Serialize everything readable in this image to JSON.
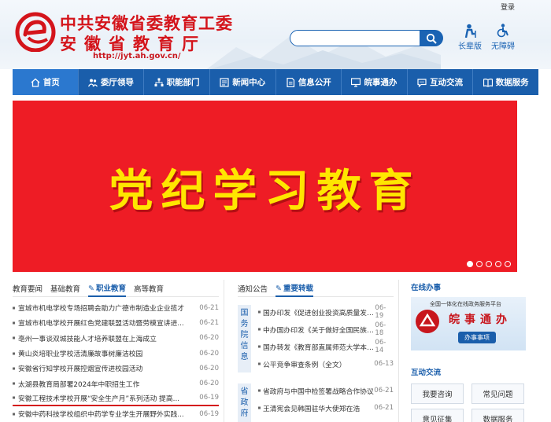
{
  "header": {
    "login": "登录",
    "title_line1": "中共安徽省委教育工委",
    "title_line2": "安徽省教育厅",
    "url": "http://jyt.ah.gov.cn/",
    "tools": [
      {
        "label": "长辈版",
        "icon": "elder-icon"
      },
      {
        "label": "无障碍",
        "icon": "accessibility-icon"
      }
    ]
  },
  "nav": {
    "items": [
      "首页",
      "委厅领导",
      "职能部门",
      "新闻中心",
      "信息公开",
      "皖事通办",
      "互动交流",
      "数据服务"
    ]
  },
  "banner": {
    "text": "党纪学习教育",
    "dots": 5,
    "active_dot": 0
  },
  "left": {
    "tabs": [
      "教育要闻",
      "基础教育",
      "职业教育",
      "高等教育"
    ],
    "active_tab": "职业教育",
    "news": [
      {
        "title": "宣城市机电学校专场招聘会助力广德市制造业企业揽才",
        "date": "06-21"
      },
      {
        "title": "宣城市机电学校开展红色党建联盟活动暨劳模宣讲进...",
        "date": "06-21"
      },
      {
        "title": "亳州一事谈双城技能人才培养联盟在上海成立",
        "date": "06-20"
      },
      {
        "title": "黄山炎培职业学校活清廉故事树廉洁校园",
        "date": "06-20"
      },
      {
        "title": "安徽省行知学校开展控烟宣传进校园活动",
        "date": "06-20"
      },
      {
        "title": "太湖县教育局部署2024年中职招生工作",
        "date": "06-20"
      },
      {
        "title": "安徽工程技术学校开展“安全生产月”系列活动 提高...",
        "date": "06-19"
      },
      {
        "title": "安徽中药科技学校组织中药学专业学生开展野外实践...",
        "date": "06-19"
      }
    ]
  },
  "middle": {
    "tabs": [
      "通知公告",
      "重要转载"
    ],
    "active_tab": "重要转载",
    "group1_tag": "国务院信息",
    "group1": [
      {
        "title": "国办印发《促进创业投资高质量发展...",
        "date": "06-19"
      },
      {
        "title": "中办国办印发《关于做好全国民族团...",
        "date": "06-18"
      },
      {
        "title": "国办转发《教育部直属师范大学本研...",
        "date": "06-14"
      },
      {
        "title": "公平竞争审查条例（全文）",
        "date": "06-13"
      }
    ],
    "group2_tag": "省政府",
    "group2": [
      {
        "title": "省政府与中国中检签署战略合作协议",
        "date": "06-21"
      },
      {
        "title": "王清宪会见韩国驻华大使郑在浩",
        "date": "06-21"
      }
    ]
  },
  "right": {
    "online_title": "在线办事",
    "online_banner_platform": "全国一体化在线政务服务平台",
    "online_banner_name": "皖事通办",
    "online_banner_button": "办事事项",
    "interact_title": "互动交流",
    "buttons": [
      "我要咨询",
      "常见问题",
      "意见征集",
      "数据服务"
    ]
  },
  "colors": {
    "brand_red": "#d4141b",
    "nav_blue": "#1a5eab",
    "banner_red": "#ee1c25",
    "banner_text": "#ffe600"
  }
}
